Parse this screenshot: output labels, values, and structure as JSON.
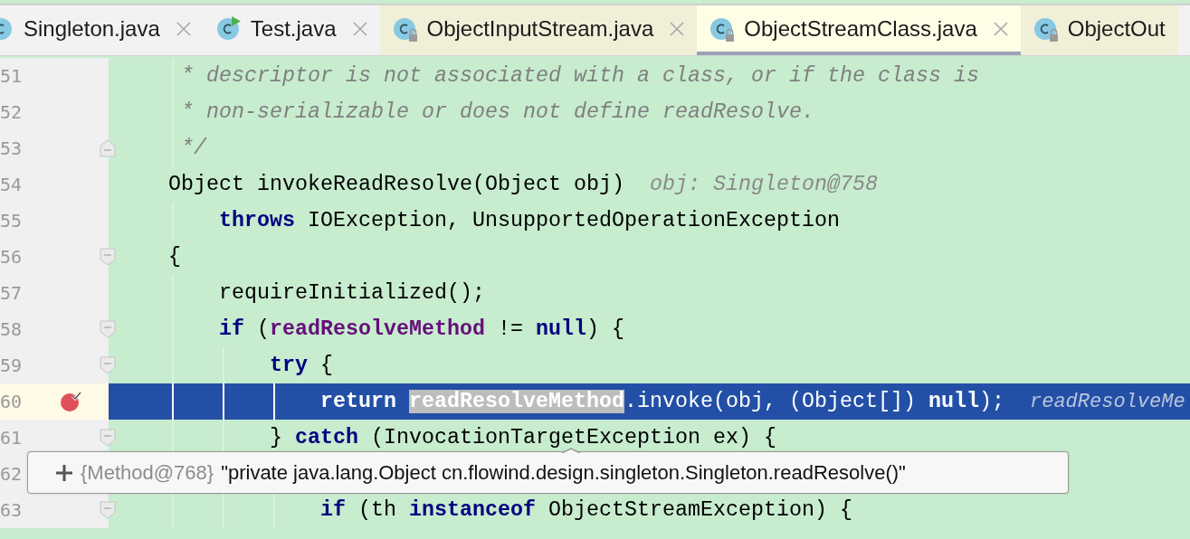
{
  "tabs": [
    {
      "label": "Singleton.java",
      "kind": "class",
      "read_only": false,
      "selected": false,
      "closable": true
    },
    {
      "label": "Test.java",
      "kind": "runnable",
      "read_only": false,
      "selected": false,
      "closable": true
    },
    {
      "label": "ObjectInputStream.java",
      "kind": "class",
      "read_only": true,
      "selected": false,
      "closable": true
    },
    {
      "label": "ObjectStreamClass.java",
      "kind": "class",
      "read_only": true,
      "selected": true,
      "closable": true
    },
    {
      "label": "ObjectOut",
      "kind": "class",
      "read_only": true,
      "selected": false,
      "closable": false
    }
  ],
  "lines": [
    {
      "number": "51",
      "fold_start": false,
      "fold_end": false,
      "current": false,
      "breakpoint": false,
      "tokens": [
        {
          "kind": "comment",
          "text": "     * descriptor is not associated with a class, or if the class is"
        }
      ]
    },
    {
      "number": "52",
      "fold_start": false,
      "fold_end": false,
      "current": false,
      "breakpoint": false,
      "tokens": [
        {
          "kind": "comment",
          "text": "     * non-serializable or does not define readResolve."
        }
      ]
    },
    {
      "number": "53",
      "fold_start": false,
      "fold_end": true,
      "current": false,
      "breakpoint": false,
      "tokens": [
        {
          "kind": "comment",
          "text": "     */"
        }
      ]
    },
    {
      "number": "54",
      "fold_start": false,
      "fold_end": false,
      "current": false,
      "breakpoint": false,
      "tokens": [
        {
          "kind": "plain",
          "text": "    Object invokeReadResolve(Object obj)  "
        },
        {
          "kind": "hint",
          "text": "obj: Singleton@758"
        }
      ]
    },
    {
      "number": "55",
      "fold_start": false,
      "fold_end": false,
      "current": false,
      "breakpoint": false,
      "tokens": [
        {
          "kind": "keyword",
          "text": "        throws"
        },
        {
          "kind": "plain",
          "text": " IOException, UnsupportedOperationException"
        }
      ]
    },
    {
      "number": "56",
      "fold_start": true,
      "fold_end": false,
      "current": false,
      "breakpoint": false,
      "tokens": [
        {
          "kind": "plain",
          "text": "    {"
        }
      ]
    },
    {
      "number": "57",
      "fold_start": false,
      "fold_end": false,
      "current": false,
      "breakpoint": false,
      "tokens": [
        {
          "kind": "plain",
          "text": "        requireInitialized();"
        }
      ]
    },
    {
      "number": "58",
      "fold_start": true,
      "fold_end": false,
      "current": false,
      "breakpoint": false,
      "tokens": [
        {
          "kind": "keyword",
          "text": "        if"
        },
        {
          "kind": "plain",
          "text": " ("
        },
        {
          "kind": "field",
          "text": "readResolveMethod"
        },
        {
          "kind": "plain",
          "text": " != "
        },
        {
          "kind": "keyword",
          "text": "null"
        },
        {
          "kind": "plain",
          "text": ") {"
        }
      ]
    },
    {
      "number": "59",
      "fold_start": true,
      "fold_end": false,
      "current": false,
      "breakpoint": false,
      "tokens": [
        {
          "kind": "keyword",
          "text": "            try"
        },
        {
          "kind": "plain",
          "text": " {"
        }
      ]
    },
    {
      "number": "60",
      "fold_start": false,
      "fold_end": false,
      "current": true,
      "breakpoint": true,
      "tokens": [
        {
          "kind": "keyword",
          "text": "                return "
        },
        {
          "kind": "selection",
          "text": "readResolveMethod"
        },
        {
          "kind": "plain",
          "text": ".invoke(obj, (Object[]) "
        },
        {
          "kind": "keyword",
          "text": "null"
        },
        {
          "kind": "plain",
          "text": ");  "
        },
        {
          "kind": "hint",
          "text": "readResolveMe"
        }
      ]
    },
    {
      "number": "61",
      "fold_start": true,
      "fold_end": false,
      "current": false,
      "breakpoint": false,
      "tokens": [
        {
          "kind": "plain",
          "text": "            } "
        },
        {
          "kind": "keyword",
          "text": "catch"
        },
        {
          "kind": "plain",
          "text": " (InvocationTargetException ex) {"
        }
      ]
    },
    {
      "number": "62",
      "fold_start": false,
      "fold_end": false,
      "current": false,
      "breakpoint": false
    },
    {
      "number": "63",
      "fold_start": true,
      "fold_end": false,
      "current": false,
      "breakpoint": false,
      "tokens": [
        {
          "kind": "keyword",
          "text": "                if"
        },
        {
          "kind": "plain",
          "text": " (th "
        },
        {
          "kind": "keyword",
          "text": "instanceof"
        },
        {
          "kind": "plain",
          "text": " ObjectStreamException) {"
        }
      ]
    }
  ],
  "tooltip": {
    "type_label": "{Method@768}",
    "value": "\"private java.lang.Object cn.flowind.design.singleton.Singleton.readResolve()\""
  }
}
